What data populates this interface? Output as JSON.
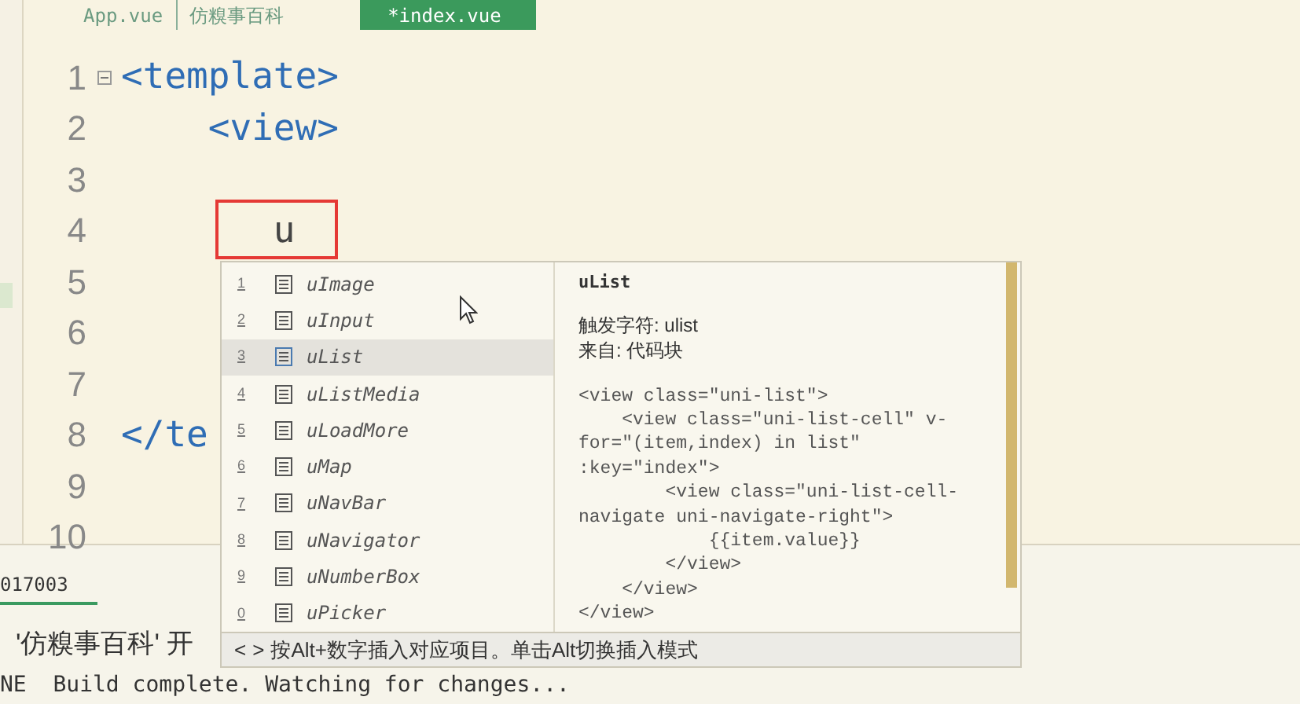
{
  "tabs": [
    {
      "label": "App.vue",
      "selected": false
    },
    {
      "label": "仿糗事百科",
      "selected": false
    },
    {
      "label": "*index.vue",
      "selected": true
    }
  ],
  "editor": {
    "lines": [
      {
        "number": "1",
        "text": "<template>",
        "foldable": true
      },
      {
        "number": "2",
        "text": "    <view>"
      },
      {
        "number": "3"
      },
      {
        "number": "4",
        "text": "       u",
        "highlighted": true
      },
      {
        "number": "5"
      },
      {
        "number": "6"
      },
      {
        "number": "7"
      },
      {
        "number": "8",
        "text": "</te"
      },
      {
        "number": "9"
      },
      {
        "number": "10"
      }
    ]
  },
  "autocomplete": {
    "items": [
      {
        "number": "1",
        "label": "uImage",
        "selected": false
      },
      {
        "number": "2",
        "label": "uInput",
        "selected": false
      },
      {
        "number": "3",
        "label": "uList",
        "selected": true
      },
      {
        "number": "4",
        "label": "uListMedia",
        "selected": false
      },
      {
        "number": "5",
        "label": "uLoadMore",
        "selected": false
      },
      {
        "number": "6",
        "label": "uMap",
        "selected": false
      },
      {
        "number": "7",
        "label": "uNavBar",
        "selected": false
      },
      {
        "number": "8",
        "label": "uNavigator",
        "selected": false
      },
      {
        "number": "9",
        "label": "uNumberBox",
        "selected": false
      },
      {
        "number": "0",
        "label": "uPicker",
        "selected": false
      }
    ],
    "detail": {
      "title": "uList",
      "trigger": "触发字符: ulist",
      "source": "来自: 代码块",
      "code": [
        "<view class=\"uni-list\">",
        "    <view class=\"uni-list-cell\" v-",
        "for=\"(item,index) in list\"",
        ":key=\"index\">",
        "        <view class=\"uni-list-cell-",
        "navigate uni-navigate-right\">",
        "            {{item.value}}",
        "        </view>",
        "    </view>",
        "</view>"
      ]
    },
    "footer": {
      "prev": "<",
      "next": ">",
      "hint": "按Alt+数字插入对应项目。单击Alt切换插入模式"
    }
  },
  "console": {
    "tab": "017003",
    "lines": [
      "'仿糗事百科' 开",
      "NE  Build complete. Watching for changes..."
    ]
  }
}
